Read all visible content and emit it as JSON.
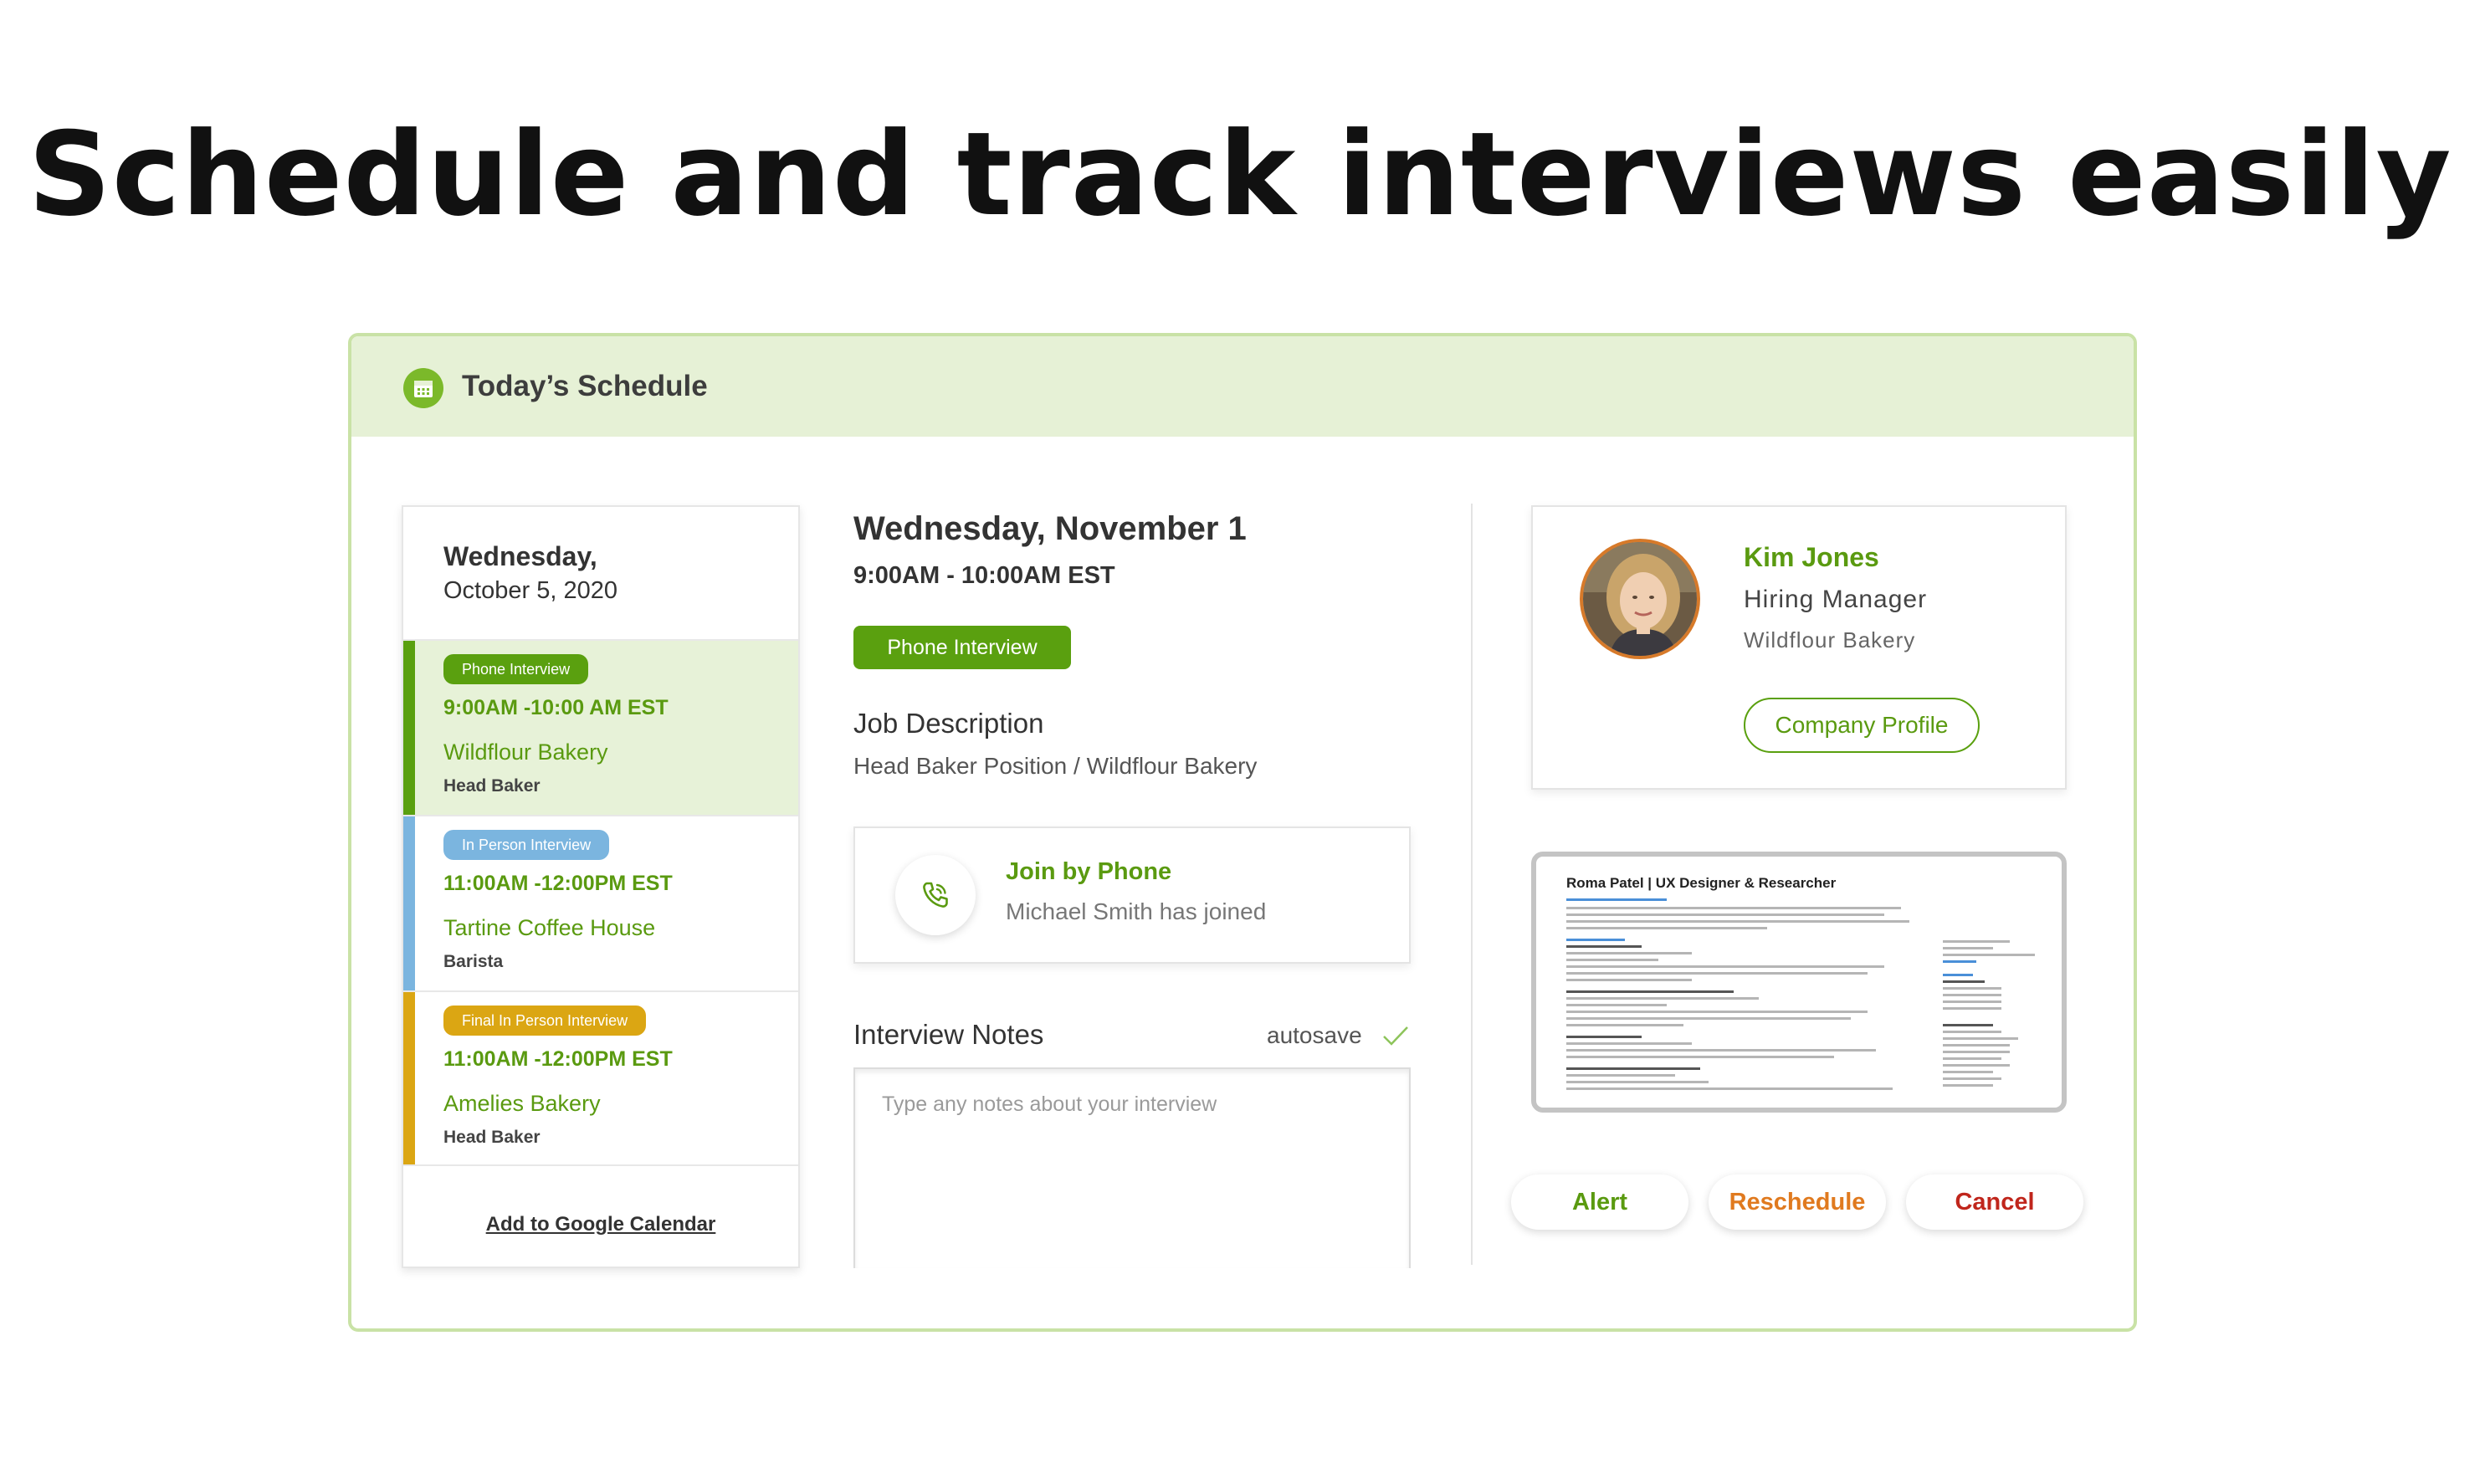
{
  "hero": {
    "title": "Schedule and track interviews easily"
  },
  "panel": {
    "title": "Today’s Schedule",
    "icon": "calendar-icon"
  },
  "day": {
    "line1": "Wednesday,",
    "line2": "October 5, 2020",
    "slots": [
      {
        "badge": "Phone Interview",
        "time": "9:00AM -10:00 AM EST",
        "company": "Wildflour Bakery",
        "role": "Head Baker",
        "color": "#5aa00f",
        "bg": "#e7f2d8"
      },
      {
        "badge": "In Person Interview",
        "time": "11:00AM -12:00PM EST",
        "company": "Tartine Coffee House",
        "role": "Barista",
        "color": "#7bb5df",
        "bg": "#ffffff"
      },
      {
        "badge": "Final In Person Interview",
        "time": "11:00AM -12:00PM EST",
        "company": "Amelies Bakery",
        "role": "Head Baker",
        "color": "#dba613",
        "bg": "#ffffff"
      }
    ],
    "gcal": "Add to Google Calendar"
  },
  "detail": {
    "date": "Wednesday, November 1",
    "time": "9:00AM - 10:00AM EST",
    "type_button": "Phone Interview",
    "jd_label": "Job Description",
    "jd_text": "Head Baker Position  / Wildflour Bakery",
    "join_title": "Join by Phone",
    "join_sub": "Michael Smith has joined",
    "notes_label": "Interview Notes",
    "autosave": "autosave",
    "notes_placeholder": "Type any notes about your interview"
  },
  "contact": {
    "name": "Kim Jones",
    "title": "Hiring Manager",
    "company": "Wildflour Bakery",
    "button": "Company Profile"
  },
  "resume": {
    "title": "Roma Patel | UX Designer & Researcher"
  },
  "actions": {
    "alert": "Alert",
    "reschedule": "Reschedule",
    "cancel": "Cancel"
  },
  "colors": {
    "accent_green": "#5aa00f",
    "alert": "#5a9a10",
    "reschedule": "#e07a1f",
    "cancel": "#c0261c"
  }
}
